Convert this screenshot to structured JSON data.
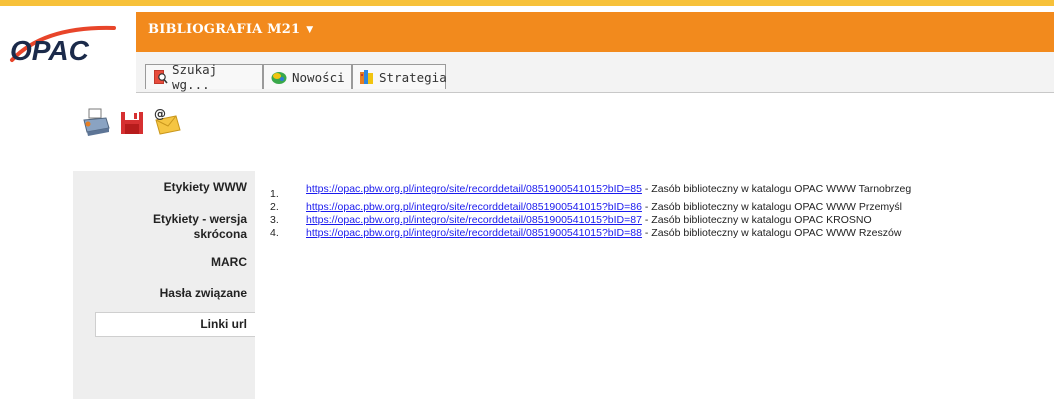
{
  "header": {
    "logo_text": "OPAC",
    "catalog_title": "BIBLIOGRAFIA M21",
    "catalog_dropdown_caret": "▼"
  },
  "tabs": [
    {
      "label": "Szukaj wg...",
      "icon": "search-book-icon"
    },
    {
      "label": "Nowości",
      "icon": "new-items-icon"
    },
    {
      "label": "Strategia",
      "icon": "strategy-books-icon"
    }
  ],
  "toolbar": [
    {
      "icon": "print-icon"
    },
    {
      "icon": "save-icon"
    },
    {
      "icon": "email-icon"
    }
  ],
  "sidebar": {
    "items": [
      {
        "label": "Etykiety WWW"
      },
      {
        "label": "Etykiety - wersja skrócona"
      },
      {
        "label": "MARC"
      },
      {
        "label": "Hasła związane"
      },
      {
        "label": "Linki url",
        "active": true
      }
    ]
  },
  "links": [
    {
      "num": "1.",
      "url": "https://opac.pbw.org.pl/integro/site/recorddetail/0851900541015?bID=85",
      "desc": " - Zasób biblioteczny w katalogu OPAC WWW Tarnobrzeg"
    },
    {
      "num": "2.",
      "url": "https://opac.pbw.org.pl/integro/site/recorddetail/0851900541015?bID=86",
      "desc": " - Zasób biblioteczny w katalogu OPAC WWW Przemyśl"
    },
    {
      "num": "3.",
      "url": "https://opac.pbw.org.pl/integro/site/recorddetail/0851900541015?bID=87",
      "desc": " - Zasób biblioteczny w katalogu OPAC KROSNO"
    },
    {
      "num": "4.",
      "url": "https://opac.pbw.org.pl/integro/site/recorddetail/0851900541015?bID=88",
      "desc": " - Zasób biblioteczny w katalogu OPAC WWW Rzeszów"
    }
  ],
  "colors": {
    "brand_orange": "#f28a1d",
    "top_strip": "#f7c13a",
    "link_blue": "#1a1aee",
    "logo_red": "#e8452a"
  }
}
